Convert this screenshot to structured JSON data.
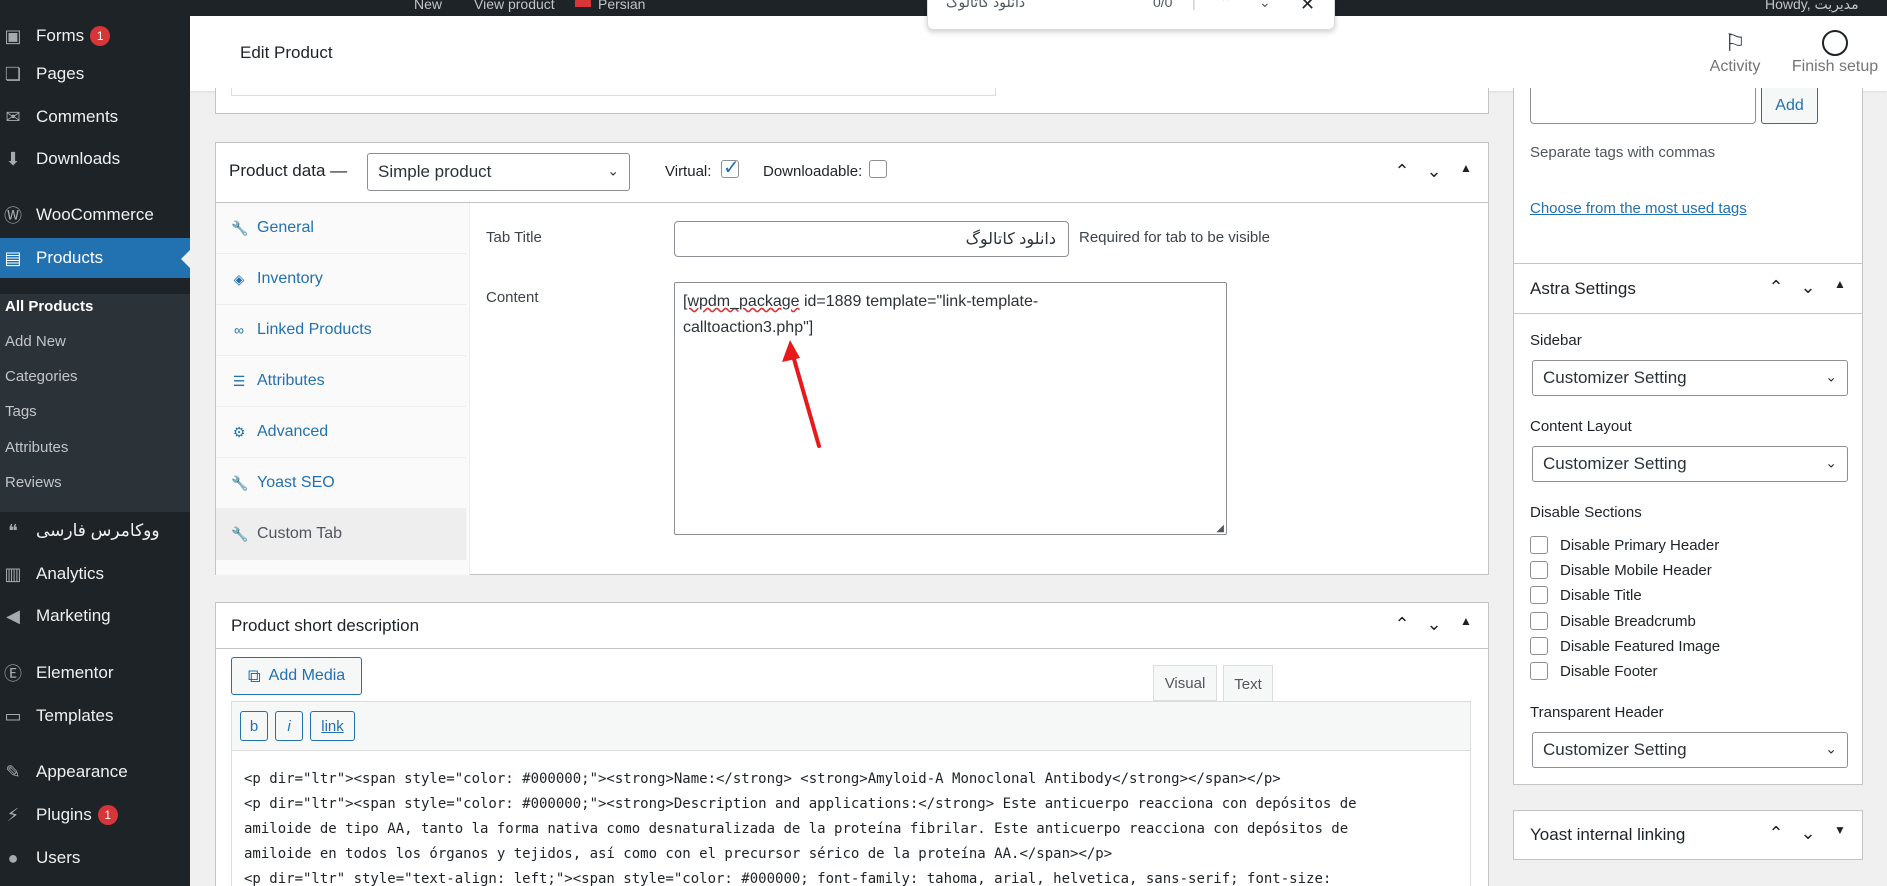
{
  "adminbar": {
    "new_label": "New",
    "view_label": "View product",
    "lang_label": "Persian",
    "greeting": "Howdy, مدیریت"
  },
  "findbar": {
    "query": "دانلود کاتالوگ",
    "count": "0/0"
  },
  "sidebar": {
    "items": [
      {
        "label": "Forms",
        "icon": "forms-icon",
        "badge": "1"
      },
      {
        "label": "Pages",
        "icon": "pages-icon"
      },
      {
        "label": "Comments",
        "icon": "comments-icon"
      },
      {
        "label": "Downloads",
        "icon": "downloads-icon"
      },
      {
        "label": "WooCommerce",
        "icon": "woocommerce-icon"
      },
      {
        "label": "Products",
        "icon": "products-icon"
      },
      {
        "label": "ووکامرس فارسی",
        "icon": "woocommerce-persian-icon"
      },
      {
        "label": "Analytics",
        "icon": "analytics-icon"
      },
      {
        "label": "Marketing",
        "icon": "marketing-icon"
      },
      {
        "label": "Elementor",
        "icon": "elementor-icon"
      },
      {
        "label": "Templates",
        "icon": "templates-icon"
      },
      {
        "label": "Appearance",
        "icon": "appearance-icon"
      },
      {
        "label": "Plugins",
        "icon": "plugins-icon",
        "badge": "1"
      },
      {
        "label": "Users",
        "icon": "users-icon"
      }
    ],
    "submenu": [
      "All Products",
      "Add New",
      "Categories",
      "Tags",
      "Attributes",
      "Reviews"
    ]
  },
  "header": {
    "title": "Edit Product",
    "activity_label": "Activity",
    "finish_label": "Finish setup"
  },
  "product_data": {
    "title": "Product data —",
    "type_value": "Simple product",
    "virtual_label": "Virtual:",
    "downloadable_label": "Downloadable:",
    "tabs": [
      "General",
      "Inventory",
      "Linked Products",
      "Attributes",
      "Advanced",
      "Yoast SEO",
      "Custom Tab"
    ],
    "tab_title_label": "Tab Title",
    "tab_title_value": "دانلود کاتالوگ",
    "tab_title_hint": "Required for tab to be visible",
    "content_label": "Content",
    "content_line1_a": "[wpdm_package",
    "content_line1_b": " id=1889 template=\"link-template-",
    "content_line2": "calltoaction3.php\"]"
  },
  "short_description": {
    "title": "Product short description",
    "add_media_label": "Add Media",
    "visual_tab": "Visual",
    "text_tab": "Text",
    "qt_bold": "b",
    "qt_italic": "i",
    "qt_link": "link",
    "code_line1": "<p dir=\"ltr\"><span style=\"color: #000000;\"><strong>Name:</strong> <strong>Amyloid-A Monoclonal Antibody</strong></span></p>",
    "code_line2": "<p dir=\"ltr\"><span style=\"color: #000000;\"><strong>Description and applications:</strong> Este anticuerpo reacciona con depósitos de",
    "code_line3": "amiloide de tipo AA, tanto la forma nativa como desnaturalizada de la proteína fibrilar. Este anticuerpo reacciona con depósitos de",
    "code_line4": "amiloide en todos los órganos y tejidos, así como con el precursor sérico de la proteína AA.</span></p>",
    "code_line5": "<p dir=\"ltr\" style=\"text-align: left;\"><span style=\"color: #000000; font-family: tahoma, arial, helvetica, sans-serif; font-size:"
  },
  "tags_box": {
    "add_label": "Add",
    "hint": "Separate tags with commas",
    "link": "Choose from the most used tags"
  },
  "astra": {
    "title": "Astra Settings",
    "sidebar_label": "Sidebar",
    "sidebar_value": "Customizer Setting",
    "content_layout_label": "Content Layout",
    "content_layout_value": "Customizer Setting",
    "disable_sections_label": "Disable Sections",
    "options": [
      "Disable Primary Header",
      "Disable Mobile Header",
      "Disable Title",
      "Disable Breadcrumb",
      "Disable Featured Image",
      "Disable Footer"
    ],
    "transparent_label": "Transparent Header",
    "transparent_value": "Customizer Setting"
  },
  "yoast": {
    "title": "Yoast internal linking"
  },
  "colors": {
    "admin_dark": "#1d2327",
    "accent_blue": "#2271b1",
    "badge_red": "#d63638",
    "annotation_arrow": "#e8191b"
  }
}
